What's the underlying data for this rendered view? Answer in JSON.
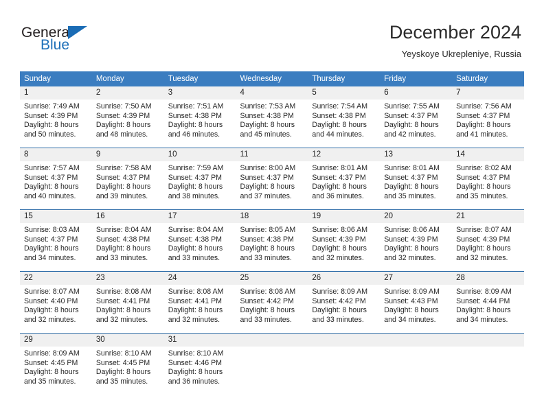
{
  "brand": {
    "name_part1": "General",
    "name_part2": "Blue",
    "triangle_icon": "triangle-icon",
    "colors": {
      "dark": "#231f20",
      "blue": "#1d6fb8"
    }
  },
  "header": {
    "title": "December 2024",
    "subtitle": "Yeyskoye Ukrepleniye, Russia"
  },
  "theme": {
    "header_bg": "#3b7dc0",
    "daynum_bg": "#f0f0f0",
    "week_separator": "#2e6da8"
  },
  "calendar": {
    "weekday_headers": [
      "Sunday",
      "Monday",
      "Tuesday",
      "Wednesday",
      "Thursday",
      "Friday",
      "Saturday"
    ],
    "weeks": [
      [
        {
          "day": "1",
          "sunrise": "Sunrise: 7:49 AM",
          "sunset": "Sunset: 4:39 PM",
          "daylight_1": "Daylight: 8 hours",
          "daylight_2": "and 50 minutes."
        },
        {
          "day": "2",
          "sunrise": "Sunrise: 7:50 AM",
          "sunset": "Sunset: 4:39 PM",
          "daylight_1": "Daylight: 8 hours",
          "daylight_2": "and 48 minutes."
        },
        {
          "day": "3",
          "sunrise": "Sunrise: 7:51 AM",
          "sunset": "Sunset: 4:38 PM",
          "daylight_1": "Daylight: 8 hours",
          "daylight_2": "and 46 minutes."
        },
        {
          "day": "4",
          "sunrise": "Sunrise: 7:53 AM",
          "sunset": "Sunset: 4:38 PM",
          "daylight_1": "Daylight: 8 hours",
          "daylight_2": "and 45 minutes."
        },
        {
          "day": "5",
          "sunrise": "Sunrise: 7:54 AM",
          "sunset": "Sunset: 4:38 PM",
          "daylight_1": "Daylight: 8 hours",
          "daylight_2": "and 44 minutes."
        },
        {
          "day": "6",
          "sunrise": "Sunrise: 7:55 AM",
          "sunset": "Sunset: 4:37 PM",
          "daylight_1": "Daylight: 8 hours",
          "daylight_2": "and 42 minutes."
        },
        {
          "day": "7",
          "sunrise": "Sunrise: 7:56 AM",
          "sunset": "Sunset: 4:37 PM",
          "daylight_1": "Daylight: 8 hours",
          "daylight_2": "and 41 minutes."
        }
      ],
      [
        {
          "day": "8",
          "sunrise": "Sunrise: 7:57 AM",
          "sunset": "Sunset: 4:37 PM",
          "daylight_1": "Daylight: 8 hours",
          "daylight_2": "and 40 minutes."
        },
        {
          "day": "9",
          "sunrise": "Sunrise: 7:58 AM",
          "sunset": "Sunset: 4:37 PM",
          "daylight_1": "Daylight: 8 hours",
          "daylight_2": "and 39 minutes."
        },
        {
          "day": "10",
          "sunrise": "Sunrise: 7:59 AM",
          "sunset": "Sunset: 4:37 PM",
          "daylight_1": "Daylight: 8 hours",
          "daylight_2": "and 38 minutes."
        },
        {
          "day": "11",
          "sunrise": "Sunrise: 8:00 AM",
          "sunset": "Sunset: 4:37 PM",
          "daylight_1": "Daylight: 8 hours",
          "daylight_2": "and 37 minutes."
        },
        {
          "day": "12",
          "sunrise": "Sunrise: 8:01 AM",
          "sunset": "Sunset: 4:37 PM",
          "daylight_1": "Daylight: 8 hours",
          "daylight_2": "and 36 minutes."
        },
        {
          "day": "13",
          "sunrise": "Sunrise: 8:01 AM",
          "sunset": "Sunset: 4:37 PM",
          "daylight_1": "Daylight: 8 hours",
          "daylight_2": "and 35 minutes."
        },
        {
          "day": "14",
          "sunrise": "Sunrise: 8:02 AM",
          "sunset": "Sunset: 4:37 PM",
          "daylight_1": "Daylight: 8 hours",
          "daylight_2": "and 35 minutes."
        }
      ],
      [
        {
          "day": "15",
          "sunrise": "Sunrise: 8:03 AM",
          "sunset": "Sunset: 4:37 PM",
          "daylight_1": "Daylight: 8 hours",
          "daylight_2": "and 34 minutes."
        },
        {
          "day": "16",
          "sunrise": "Sunrise: 8:04 AM",
          "sunset": "Sunset: 4:38 PM",
          "daylight_1": "Daylight: 8 hours",
          "daylight_2": "and 33 minutes."
        },
        {
          "day": "17",
          "sunrise": "Sunrise: 8:04 AM",
          "sunset": "Sunset: 4:38 PM",
          "daylight_1": "Daylight: 8 hours",
          "daylight_2": "and 33 minutes."
        },
        {
          "day": "18",
          "sunrise": "Sunrise: 8:05 AM",
          "sunset": "Sunset: 4:38 PM",
          "daylight_1": "Daylight: 8 hours",
          "daylight_2": "and 33 minutes."
        },
        {
          "day": "19",
          "sunrise": "Sunrise: 8:06 AM",
          "sunset": "Sunset: 4:39 PM",
          "daylight_1": "Daylight: 8 hours",
          "daylight_2": "and 32 minutes."
        },
        {
          "day": "20",
          "sunrise": "Sunrise: 8:06 AM",
          "sunset": "Sunset: 4:39 PM",
          "daylight_1": "Daylight: 8 hours",
          "daylight_2": "and 32 minutes."
        },
        {
          "day": "21",
          "sunrise": "Sunrise: 8:07 AM",
          "sunset": "Sunset: 4:39 PM",
          "daylight_1": "Daylight: 8 hours",
          "daylight_2": "and 32 minutes."
        }
      ],
      [
        {
          "day": "22",
          "sunrise": "Sunrise: 8:07 AM",
          "sunset": "Sunset: 4:40 PM",
          "daylight_1": "Daylight: 8 hours",
          "daylight_2": "and 32 minutes."
        },
        {
          "day": "23",
          "sunrise": "Sunrise: 8:08 AM",
          "sunset": "Sunset: 4:41 PM",
          "daylight_1": "Daylight: 8 hours",
          "daylight_2": "and 32 minutes."
        },
        {
          "day": "24",
          "sunrise": "Sunrise: 8:08 AM",
          "sunset": "Sunset: 4:41 PM",
          "daylight_1": "Daylight: 8 hours",
          "daylight_2": "and 32 minutes."
        },
        {
          "day": "25",
          "sunrise": "Sunrise: 8:08 AM",
          "sunset": "Sunset: 4:42 PM",
          "daylight_1": "Daylight: 8 hours",
          "daylight_2": "and 33 minutes."
        },
        {
          "day": "26",
          "sunrise": "Sunrise: 8:09 AM",
          "sunset": "Sunset: 4:42 PM",
          "daylight_1": "Daylight: 8 hours",
          "daylight_2": "and 33 minutes."
        },
        {
          "day": "27",
          "sunrise": "Sunrise: 8:09 AM",
          "sunset": "Sunset: 4:43 PM",
          "daylight_1": "Daylight: 8 hours",
          "daylight_2": "and 34 minutes."
        },
        {
          "day": "28",
          "sunrise": "Sunrise: 8:09 AM",
          "sunset": "Sunset: 4:44 PM",
          "daylight_1": "Daylight: 8 hours",
          "daylight_2": "and 34 minutes."
        }
      ],
      [
        {
          "day": "29",
          "sunrise": "Sunrise: 8:09 AM",
          "sunset": "Sunset: 4:45 PM",
          "daylight_1": "Daylight: 8 hours",
          "daylight_2": "and 35 minutes."
        },
        {
          "day": "30",
          "sunrise": "Sunrise: 8:10 AM",
          "sunset": "Sunset: 4:45 PM",
          "daylight_1": "Daylight: 8 hours",
          "daylight_2": "and 35 minutes."
        },
        {
          "day": "31",
          "sunrise": "Sunrise: 8:10 AM",
          "sunset": "Sunset: 4:46 PM",
          "daylight_1": "Daylight: 8 hours",
          "daylight_2": "and 36 minutes."
        },
        {
          "day": "",
          "sunrise": "",
          "sunset": "",
          "daylight_1": "",
          "daylight_2": ""
        },
        {
          "day": "",
          "sunrise": "",
          "sunset": "",
          "daylight_1": "",
          "daylight_2": ""
        },
        {
          "day": "",
          "sunrise": "",
          "sunset": "",
          "daylight_1": "",
          "daylight_2": ""
        },
        {
          "day": "",
          "sunrise": "",
          "sunset": "",
          "daylight_1": "",
          "daylight_2": ""
        }
      ]
    ]
  }
}
